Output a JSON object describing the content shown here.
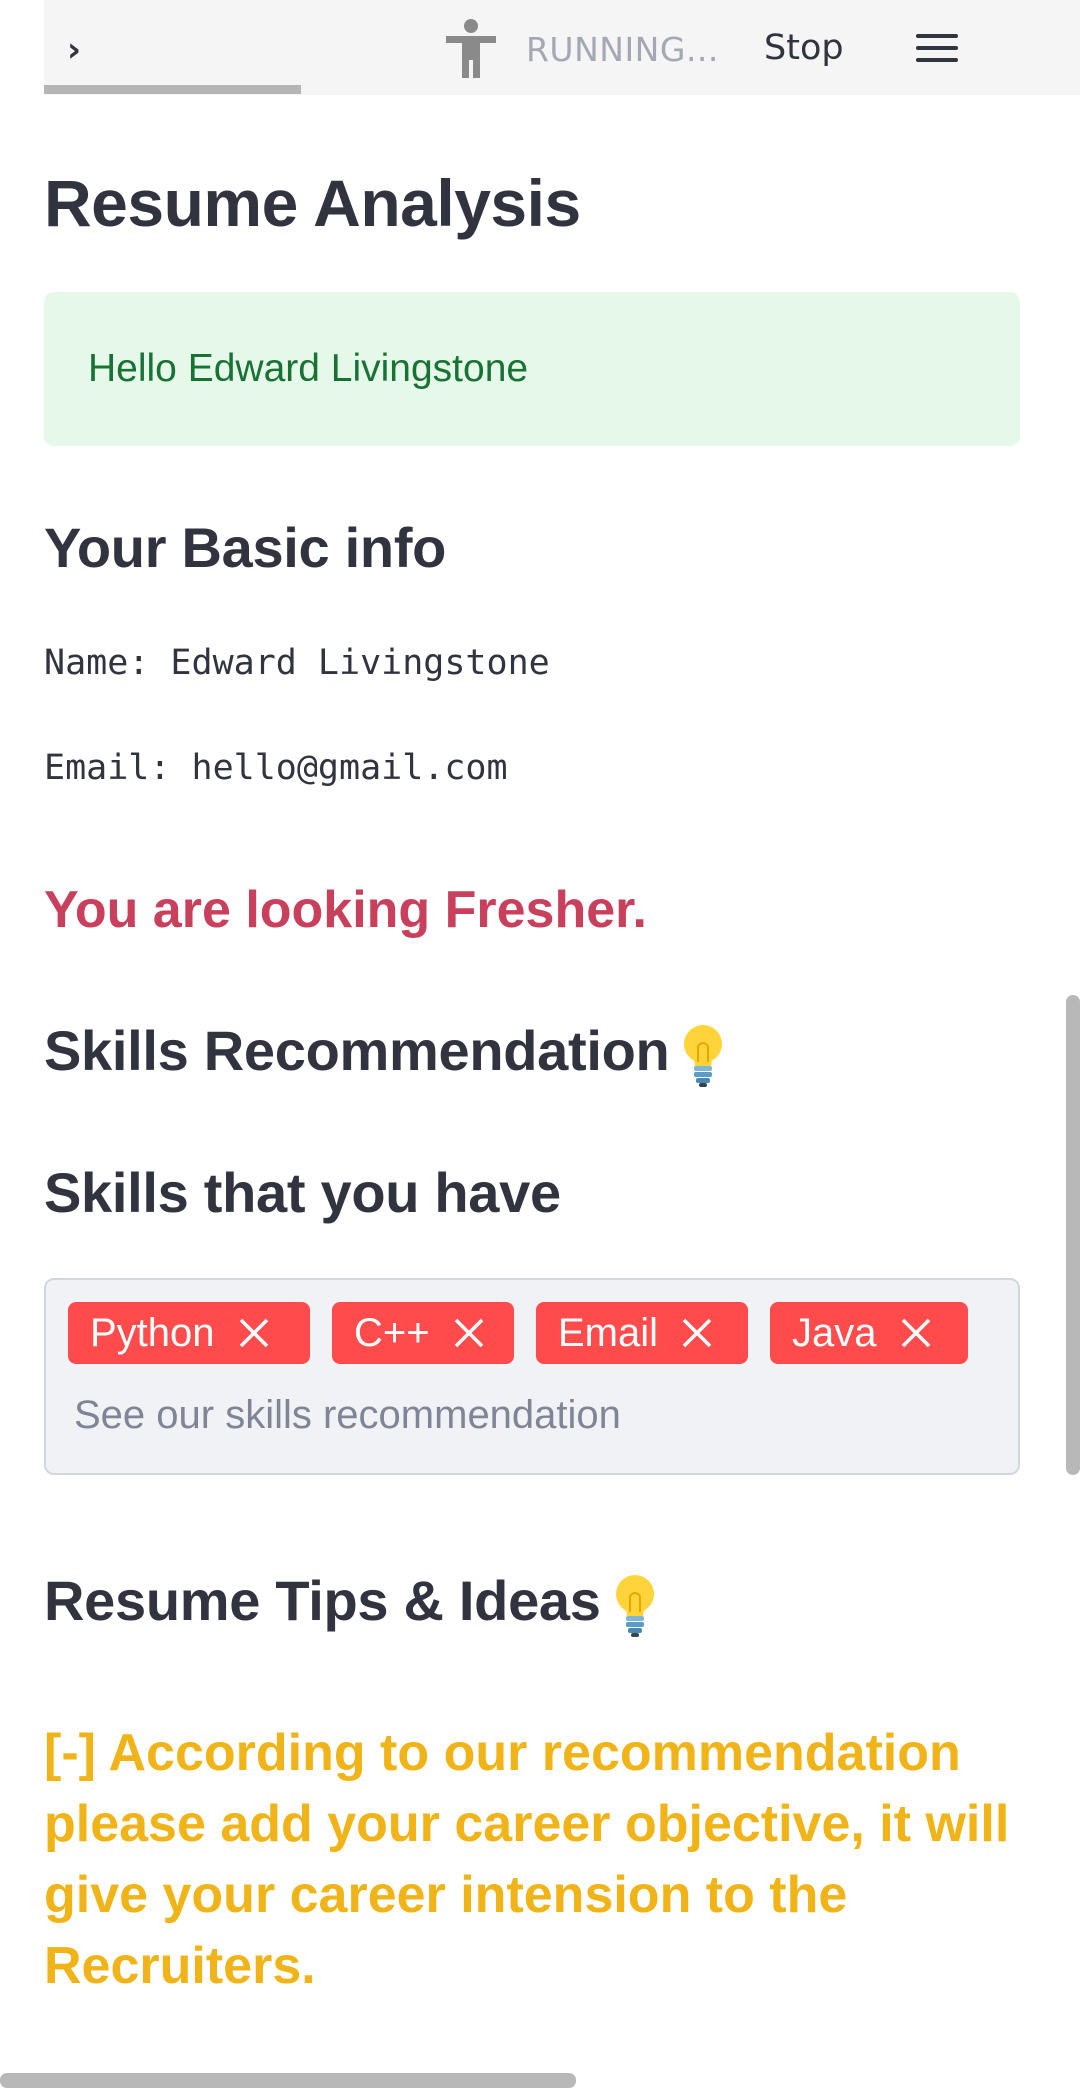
{
  "toolbar": {
    "expand_icon": "chevron-right-icon",
    "run_icon": "running-person-icon",
    "status": "RUNNING...",
    "stop_label": "Stop",
    "menu_icon": "hamburger-menu-icon"
  },
  "main": {
    "title": "Resume Analysis",
    "greeting": "Hello Edward Livingstone",
    "basic_info_heading": "Your Basic info",
    "name_line": "Name: Edward Livingstone",
    "email_line": "Email: hello@gmail.com",
    "level_message": "You are looking Fresher.",
    "skills_rec_heading": "Skills Recommendation",
    "skills_have_heading": "Skills that you have",
    "skills": [
      {
        "label": "Python"
      },
      {
        "label": "C++"
      },
      {
        "label": "Email"
      },
      {
        "label": "Java"
      }
    ],
    "skills_placeholder": "See our skills recommendation",
    "tips_heading": "Resume Tips & Ideas",
    "tip_text": "[-] According to our recommendation please add your career objective, it will give your career intension to the Recruiters."
  },
  "colors": {
    "success_bg": "#e6f8ea",
    "success_text": "#177233",
    "fresher_text": "#c9405c",
    "chip_bg": "#ff4b4b",
    "tip_text": "#f0b418"
  }
}
